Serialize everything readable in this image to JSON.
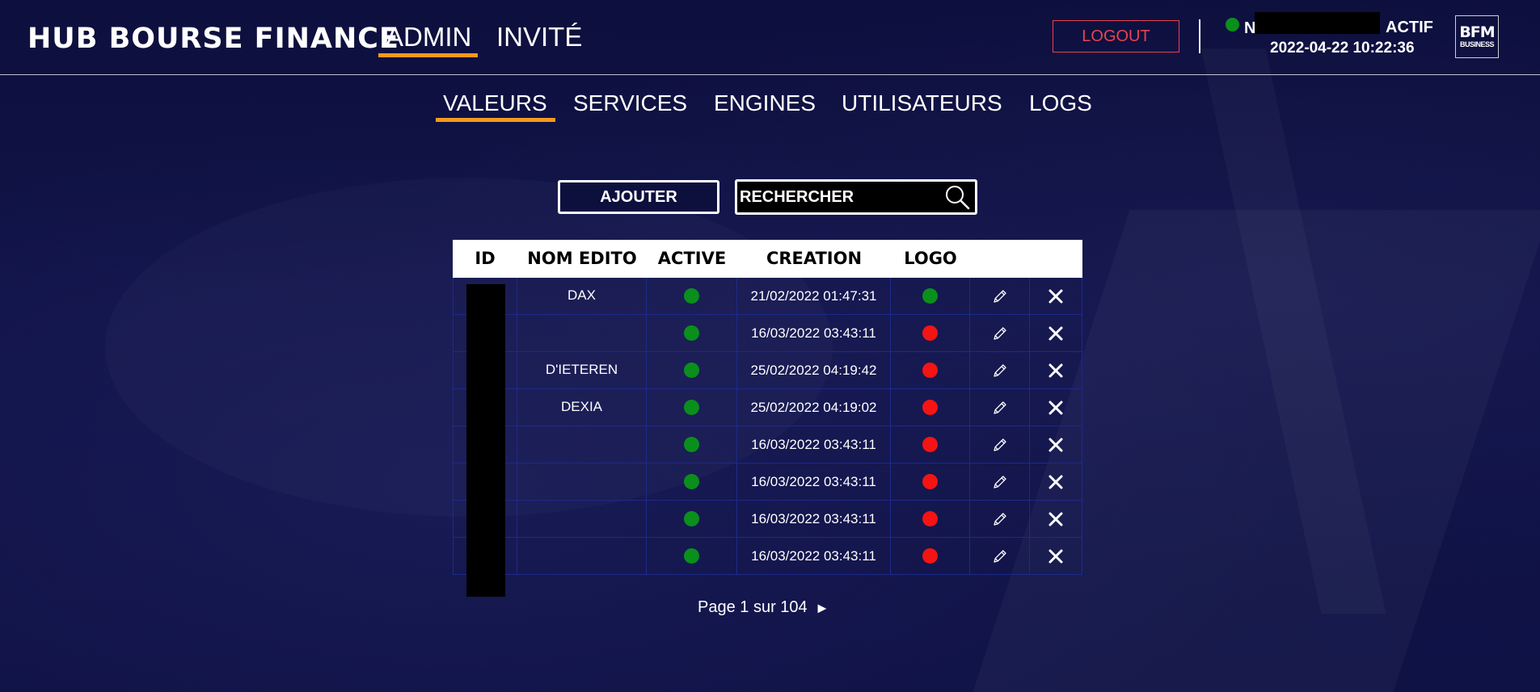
{
  "header": {
    "brand": "HUB BOURSE FINANCE",
    "nav": [
      {
        "label": "ADMIN",
        "active": true
      },
      {
        "label": "INVITÉ",
        "active": false
      }
    ],
    "logout_label": "LOGOUT",
    "user_initial": "N",
    "status_text": "ACTIF",
    "status_color": "#0a8f1c",
    "datetime": "2022-04-22 10:22:36",
    "logo": {
      "line1": "BFM",
      "line2": "BUSINESS"
    }
  },
  "subnav": [
    {
      "label": "VALEURS",
      "active": true
    },
    {
      "label": "SERVICES",
      "active": false
    },
    {
      "label": "ENGINES",
      "active": false
    },
    {
      "label": "UTILISATEURS",
      "active": false
    },
    {
      "label": "LOGS",
      "active": false
    }
  ],
  "actions": {
    "add_label": "AJOUTER",
    "search_placeholder": "RECHERCHER"
  },
  "table": {
    "columns": [
      "ID",
      "NOM EDITO",
      "ACTIVE",
      "CREATION",
      "LOGO",
      "",
      ""
    ],
    "rows": [
      {
        "nom": "DAX",
        "active": true,
        "creation": "21/02/2022 01:47:31",
        "logo": true
      },
      {
        "nom": "",
        "active": true,
        "creation": "16/03/2022 03:43:11",
        "logo": false
      },
      {
        "nom": "D'IETEREN",
        "active": true,
        "creation": "25/02/2022 04:19:42",
        "logo": false
      },
      {
        "nom": "DEXIA",
        "active": true,
        "creation": "25/02/2022 04:19:02",
        "logo": false
      },
      {
        "nom": "",
        "active": true,
        "creation": "16/03/2022 03:43:11",
        "logo": false
      },
      {
        "nom": "",
        "active": true,
        "creation": "16/03/2022 03:43:11",
        "logo": false
      },
      {
        "nom": "",
        "active": true,
        "creation": "16/03/2022 03:43:11",
        "logo": false
      },
      {
        "nom": "",
        "active": true,
        "creation": "16/03/2022 03:43:11",
        "logo": false
      }
    ]
  },
  "pagination": {
    "text": "Page 1 sur 104",
    "next_glyph": "►"
  },
  "colors": {
    "accent": "#f39a1e",
    "logout": "#e8434f",
    "ok": "#0a8f1c",
    "ko": "#f41414",
    "background": "#0d0f3d"
  },
  "icons": {
    "search": "search-icon",
    "edit": "pencil-icon",
    "delete": "close-icon"
  }
}
